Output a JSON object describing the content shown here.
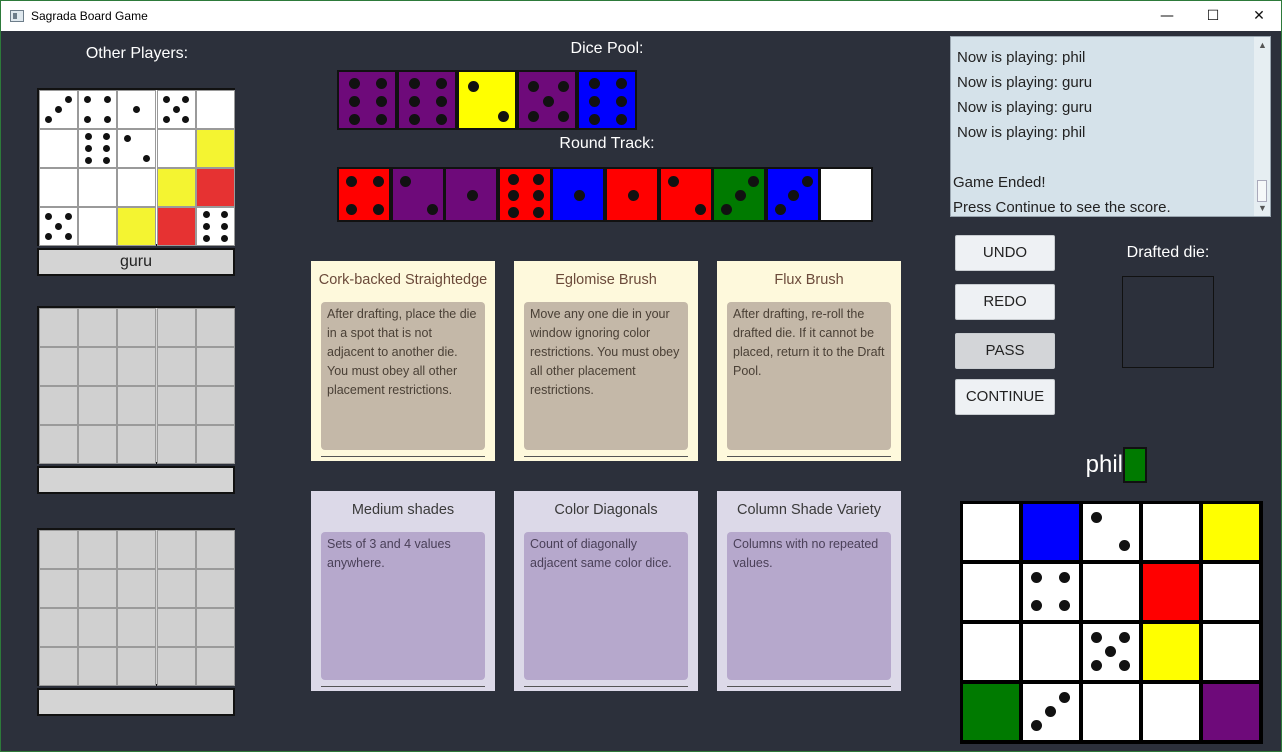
{
  "window": {
    "title": "Sagrada Board Game",
    "minimize": "—",
    "maximize": "☐",
    "close": "✕"
  },
  "labels": {
    "other_players": "Other Players:",
    "dice_pool": "Dice Pool:",
    "round_track": "Round Track:",
    "drafted_die": "Drafted die:"
  },
  "colors": {
    "purple": "#6e0a7a",
    "yellow": "#ffff00",
    "blue": "#0000ff",
    "red": "#ff0000",
    "red_other": "#e63232",
    "green": "#007a00",
    "white": "#ffffff",
    "empty": "#d0d0d0",
    "pale_yellow": "#f4f431"
  },
  "dice_pool": [
    {
      "color": "purple",
      "value": 6
    },
    {
      "color": "purple",
      "value": 6
    },
    {
      "color": "yellow",
      "value": 2
    },
    {
      "color": "purple",
      "value": 5
    },
    {
      "color": "blue",
      "value": 6
    }
  ],
  "round_track": [
    {
      "color": "red",
      "value": 4
    },
    {
      "color": "purple",
      "value": 2
    },
    {
      "color": "purple",
      "value": 1
    },
    {
      "color": "red",
      "value": 6
    },
    {
      "color": "blue",
      "value": 1
    },
    {
      "color": "red",
      "value": 1
    },
    {
      "color": "red",
      "value": 2
    },
    {
      "color": "green",
      "value": 3
    },
    {
      "color": "blue",
      "value": 3
    },
    {
      "color": "white",
      "value": 0
    }
  ],
  "other_players": [
    {
      "name": "guru",
      "grid": [
        [
          {
            "color": "white",
            "value": 3
          },
          {
            "color": "white",
            "value": 4
          },
          {
            "color": "white",
            "value": 1
          },
          {
            "color": "white",
            "value": 5
          },
          {
            "color": "white",
            "value": 0
          }
        ],
        [
          {
            "color": "white",
            "value": 0
          },
          {
            "color": "white",
            "value": 6
          },
          {
            "color": "white",
            "value": 2
          },
          {
            "color": "white",
            "value": 0
          },
          {
            "color": "pale_yellow",
            "value": 0
          }
        ],
        [
          {
            "color": "white",
            "value": 0
          },
          {
            "color": "white",
            "value": 0
          },
          {
            "color": "white",
            "value": 0
          },
          {
            "color": "pale_yellow",
            "value": 0
          },
          {
            "color": "red_other",
            "value": 0
          }
        ],
        [
          {
            "color": "white",
            "value": 5
          },
          {
            "color": "white",
            "value": 0
          },
          {
            "color": "pale_yellow",
            "value": 0
          },
          {
            "color": "red_other",
            "value": 0
          },
          {
            "color": "white",
            "value": 6
          }
        ]
      ]
    },
    {
      "name": "",
      "grid": null
    },
    {
      "name": "",
      "grid": null
    }
  ],
  "tool_cards": [
    {
      "title": "Cork-backed Straightedge",
      "text": "After drafting, place the die in a spot that is not adjacent to another die. You must obey all other placement restrictions."
    },
    {
      "title": "Eglomise Brush",
      "text": "Move any one die in your window ignoring color restrictions. You must obey all other placement restrictions."
    },
    {
      "title": "Flux Brush",
      "text": "After drafting, re-roll the drafted die. If it cannot be placed, return it to the Draft Pool."
    }
  ],
  "objective_cards": [
    {
      "title": "Medium shades",
      "text": "Sets of 3 and 4 values anywhere."
    },
    {
      "title": "Color Diagonals",
      "text": "Count of diagonally adjacent same color dice."
    },
    {
      "title": "Column Shade Variety",
      "text": "Columns with no repeated values."
    }
  ],
  "log": [
    "Now is playing: phil",
    "Now is playing: guru",
    "Now is playing: guru",
    "Now is playing: phil",
    "",
    "Game Ended!",
    "Press Continue to see the score."
  ],
  "buttons": {
    "undo": "UNDO",
    "redo": "REDO",
    "pass": "PASS",
    "continue": "CONTINUE"
  },
  "me": {
    "name": "phil",
    "color": "green",
    "grid": [
      [
        {
          "color": "white",
          "value": 0
        },
        {
          "color": "blue",
          "value": 0
        },
        {
          "color": "white",
          "value": 2
        },
        {
          "color": "white",
          "value": 0
        },
        {
          "color": "yellow",
          "value": 0
        }
      ],
      [
        {
          "color": "white",
          "value": 0
        },
        {
          "color": "white",
          "value": 4
        },
        {
          "color": "white",
          "value": 0
        },
        {
          "color": "red",
          "value": 0
        },
        {
          "color": "white",
          "value": 0
        }
      ],
      [
        {
          "color": "white",
          "value": 0
        },
        {
          "color": "white",
          "value": 0
        },
        {
          "color": "white",
          "value": 5
        },
        {
          "color": "yellow",
          "value": 0
        },
        {
          "color": "white",
          "value": 0
        }
      ],
      [
        {
          "color": "green",
          "value": 0
        },
        {
          "color": "white",
          "value": 3
        },
        {
          "color": "white",
          "value": 0
        },
        {
          "color": "white",
          "value": 0
        },
        {
          "color": "purple",
          "value": 0
        }
      ]
    ]
  }
}
